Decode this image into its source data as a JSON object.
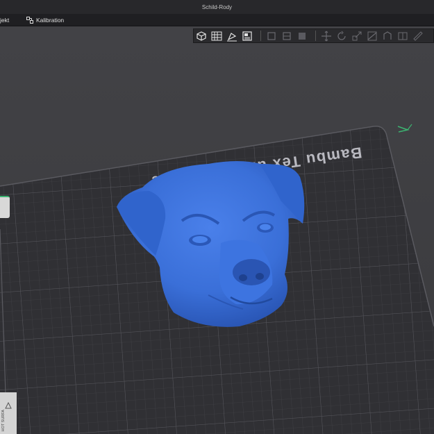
{
  "window": {
    "title": "Schild-Rody"
  },
  "menu": {
    "project_label": "jekt",
    "calibration_label": "Kalibration"
  },
  "plate": {
    "label": "Bambu Textured PEI Plate",
    "label_visible": "Bambu Tex         ured PEI Plate"
  },
  "corner_panel": {
    "text": "HOT SURFA"
  },
  "colors": {
    "model": "#3a6fd8",
    "plate": "#303034",
    "background": "#3e3e42",
    "axis": "#3cb371"
  },
  "icons": {
    "toolbar": [
      "add-cube-icon",
      "arrange-grid-icon",
      "orient-icon",
      "plates-icon",
      "split-icon",
      "layers-icon",
      "variable-icon",
      "move-icon",
      "rotate-icon",
      "scale-icon",
      "cut-icon",
      "support-paint-icon",
      "seam-paint-icon",
      "measure-icon"
    ]
  }
}
